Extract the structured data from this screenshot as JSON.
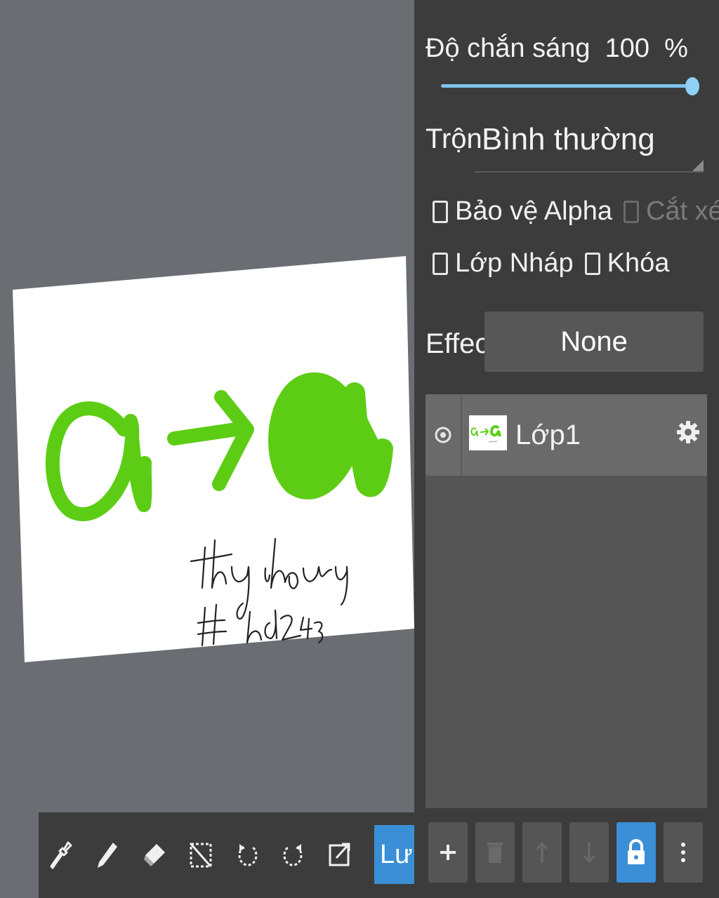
{
  "canvas": {
    "artwork": "Handwritten drawing on white canvas: green letter a, arrow, bold green a, handwritten signature text"
  },
  "toolbar": {
    "tools": [
      {
        "name": "eyedropper-icon"
      },
      {
        "name": "pencil-icon"
      },
      {
        "name": "eraser-icon"
      },
      {
        "name": "deselect-icon"
      },
      {
        "name": "undo-icon"
      },
      {
        "name": "redo-icon"
      },
      {
        "name": "export-icon"
      }
    ],
    "save_label": "Lưu"
  },
  "panel": {
    "opacity_label": "Độ chắn sáng",
    "opacity_value": "100",
    "opacity_unit": "%",
    "opacity_fraction": 1.0,
    "blend_label": "Trộn",
    "blend_value": "Bình thường",
    "checkboxes": {
      "protect_alpha": "Bảo vệ Alpha",
      "clipping": "Cắt xén",
      "draft_layer": "Lớp Nháp",
      "lock": "Khóa"
    },
    "effect_label": "Effect",
    "effect_value": "None"
  },
  "layers": [
    {
      "name": "Lớp1",
      "visible": true
    }
  ],
  "colors": {
    "accent": "#3a8fd6",
    "stroke_green": "#5ccd14",
    "panel_bg": "#3c3c3c",
    "canvas_bg": "#6a6d72"
  }
}
